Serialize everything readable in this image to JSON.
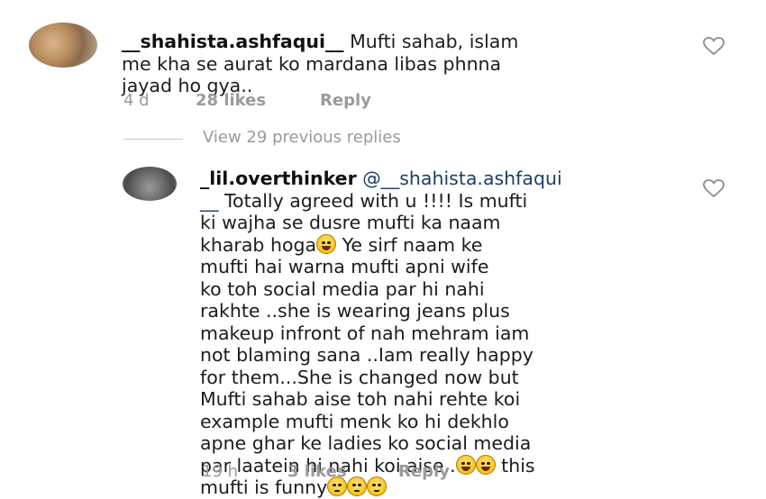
{
  "comment_1": {
    "username": "__shahista.ashfaqui__",
    "text": " Mufti sahab, islam\nme kha se aurat ko mardana libas phnna\njayad ho gya..",
    "time": "4 d",
    "likes": "28 likes",
    "reply": "Reply"
  },
  "replies_toggle": "View 29 previous replies",
  "comment_2": {
    "username": "_lil.overthinker",
    "mention_part1": " @__shahista.ashfaqui",
    "mention_part2": "__",
    "text_a": " Totally agreed with u !!!! Is mufti\nki wajha se dusre mufti ka naam\nkharab hoga",
    "text_b": " Ye sirf naam ke\nmufti hai warna mufti apni wife\nko toh social media par hi nahi\nrakhte ..she is wearing jeans plus\nmakeup infront of nah mehram iam\nnot blaming sana ..Iam really happy\nfor them...She is changed now but\nMufti sahab aise toh nahi rehte koi\nexample mufti menk ko hi dekhlo\napne ghar ke ladies ko social media\npar laatein hi nahi koi aise..",
    "text_c": " this\nmufti is funny",
    "time": "19 h",
    "likes": "3 likes",
    "reply": "Reply"
  },
  "icons": {
    "heart": "heart-outline-icon",
    "laugh_emoji": "face-with-tears-of-joy-emoji",
    "flat_emoji": "face-without-mouth-emoji"
  }
}
